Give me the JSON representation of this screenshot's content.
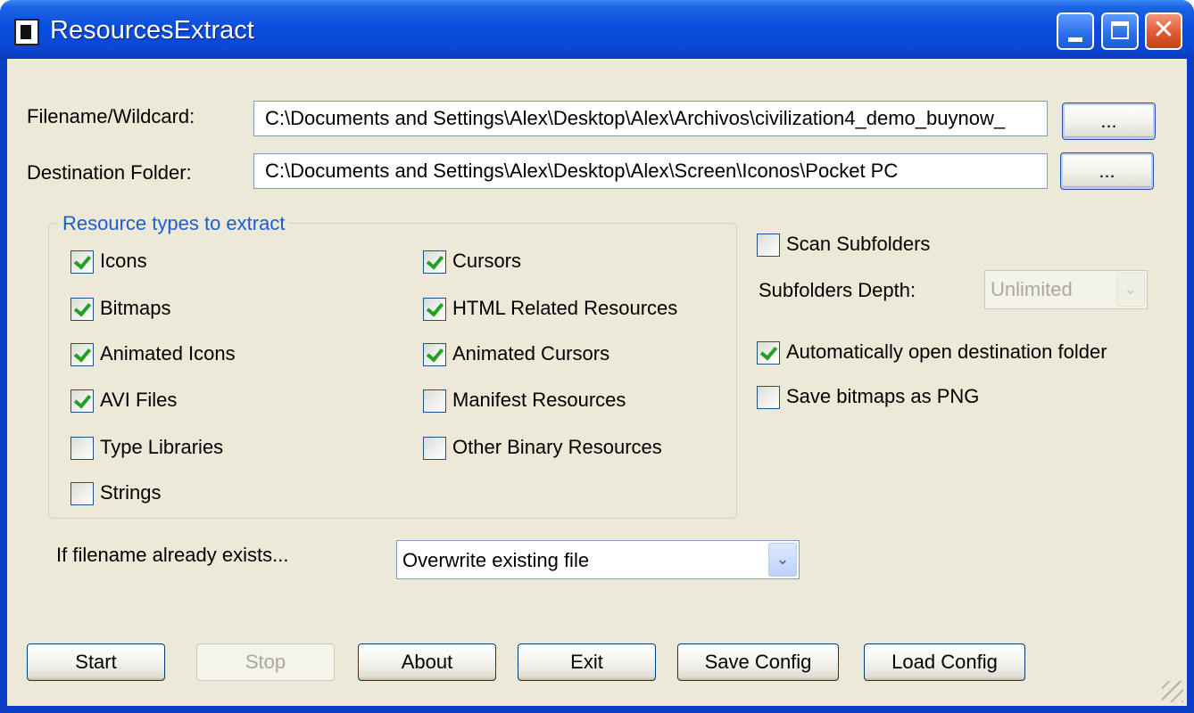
{
  "window": {
    "title": "ResourcesExtract",
    "controls": {
      "minimize": "",
      "maximize": "",
      "close": "✕"
    }
  },
  "filename": {
    "label": "Filename/Wildcard:",
    "value": "C:\\Documents and Settings\\Alex\\Desktop\\Alex\\Archivos\\civilization4_demo_buynow_",
    "browse_label": "..."
  },
  "destination": {
    "label": "Destination Folder:",
    "value": "C:\\Documents and Settings\\Alex\\Desktop\\Alex\\Screen\\Iconos\\Pocket PC",
    "browse_label": "..."
  },
  "resource_types": {
    "title": "Resource types to extract",
    "left": [
      {
        "label": "Icons",
        "checked": true
      },
      {
        "label": "Bitmaps",
        "checked": true
      },
      {
        "label": "Animated Icons",
        "checked": true
      },
      {
        "label": "AVI Files",
        "checked": true
      },
      {
        "label": "Type Libraries",
        "checked": false
      },
      {
        "label": "Strings",
        "checked": false
      }
    ],
    "right": [
      {
        "label": "Cursors",
        "checked": true
      },
      {
        "label": "HTML Related Resources",
        "checked": true
      },
      {
        "label": "Animated Cursors",
        "checked": true
      },
      {
        "label": "Manifest Resources",
        "checked": false
      },
      {
        "label": "Other Binary Resources",
        "checked": false
      }
    ]
  },
  "options": {
    "scan_subfolders": {
      "label": "Scan Subfolders",
      "checked": false
    },
    "subfolders_depth": {
      "label": "Subfolders Depth:",
      "value": "Unlimited",
      "disabled": true
    },
    "auto_open": {
      "label": "Automatically open destination folder",
      "checked": true
    },
    "save_png": {
      "label": "Save bitmaps as PNG",
      "checked": false
    }
  },
  "exists": {
    "label": "If filename already exists...",
    "value": "Overwrite existing file"
  },
  "buttons": {
    "start": "Start",
    "stop": "Stop",
    "about": "About",
    "exit": "Exit",
    "save_config": "Save Config",
    "load_config": "Load Config"
  },
  "colors": {
    "titlebar": "#0a4ee0",
    "dialog_bg": "#ece9d8",
    "group_title": "#1c5bd4",
    "check_mark": "#21a121"
  }
}
